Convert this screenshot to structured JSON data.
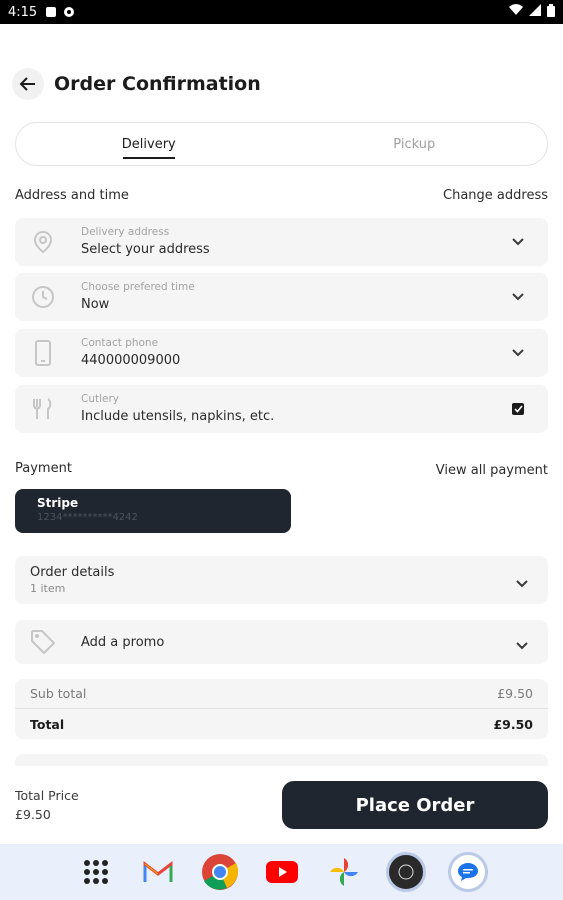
{
  "status_bar": {
    "time": "4:15"
  },
  "header": {
    "title": "Order Confirmation"
  },
  "tabs": [
    {
      "label": "Delivery",
      "active": true
    },
    {
      "label": "Pickup",
      "active": false
    }
  ],
  "address_section": {
    "title": "Address and time",
    "action": "Change address"
  },
  "fields": [
    {
      "label": "Delivery address",
      "value": "Select your address",
      "icon": "location-pin-icon"
    },
    {
      "label": "Choose prefered time",
      "value": "Now",
      "icon": "clock-icon"
    },
    {
      "label": "Contact phone",
      "value": "440000009000",
      "icon": "phone-icon"
    },
    {
      "label": "Cutlery",
      "value": "Include utensils, napkins, etc.",
      "icon": "cutlery-icon",
      "checked": true
    }
  ],
  "payment_section": {
    "title": "Payment",
    "action": "View all payment"
  },
  "payment_card": {
    "name": "Stripe",
    "number": "1234**********4242"
  },
  "order_details": {
    "title": "Order details",
    "subtitle": "1 item"
  },
  "promo": {
    "label": "Add a promo"
  },
  "totals": {
    "sub_total_label": "Sub total",
    "sub_total_value": "£9.50",
    "total_label": "Total",
    "total_value": "£9.50"
  },
  "bottom_bar": {
    "total_price_label": "Total Price",
    "total_price_value": "£9.50",
    "place_order_label": "Place Order"
  },
  "dock_apps": [
    "app-launcher",
    "gmail",
    "chrome",
    "youtube",
    "photos",
    "account",
    "messages"
  ],
  "colors": {
    "primary_dark": "#1f2630",
    "field_bg": "#f5f5f5",
    "muted_text": "#a3a3a3"
  }
}
